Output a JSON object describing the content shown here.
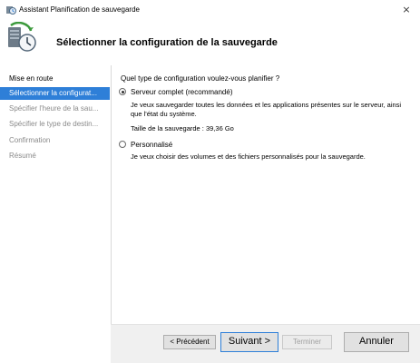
{
  "window": {
    "title": "Assistant Planification de sauvegarde",
    "close_glyph": "×"
  },
  "header": {
    "title": "Sélectionner la configuration de la sauvegarde",
    "icon": "backup-schedule-icon"
  },
  "sidebar": {
    "items": [
      {
        "label": "Mise en route",
        "state": "done"
      },
      {
        "label": "Sélectionner la configurat...",
        "state": "active"
      },
      {
        "label": "Spécifier l'heure de la sau...",
        "state": "pending"
      },
      {
        "label": "Spécifier le type de destin...",
        "state": "pending"
      },
      {
        "label": "Confirmation",
        "state": "pending"
      },
      {
        "label": "Résumé",
        "state": "pending"
      }
    ]
  },
  "main": {
    "question": "Quel type de configuration voulez-vous planifier ?",
    "options": [
      {
        "label": "Serveur complet (recommandé)",
        "checked": true,
        "description": "Je veux sauvegarder toutes les données et les applications présentes sur le serveur, ainsi que l'état du système.",
        "size_text": "Taille de la sauvegarde : 39,36 Go"
      },
      {
        "label": "Personnalisé",
        "checked": false,
        "description": "Je veux choisir des volumes et des fichiers personnalisés pour la sauvegarde."
      }
    ]
  },
  "footer": {
    "previous_label": "< Précédent",
    "next_label": "Suivant >",
    "finish_label": "Terminer",
    "cancel_label": "Annuler"
  },
  "colors": {
    "accent": "#2e7fd8",
    "disabled_text": "#8a8a8a"
  }
}
